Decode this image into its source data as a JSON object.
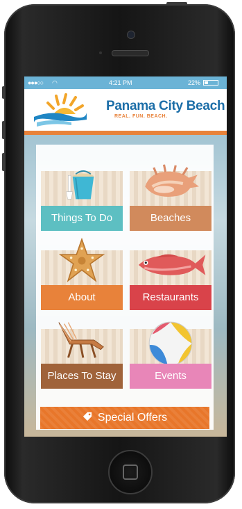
{
  "status_bar": {
    "time": "4:21 PM",
    "battery": "22%"
  },
  "header": {
    "brand": "Panama City Beach",
    "tagline": "REAL. FUN. BEACH."
  },
  "tiles": [
    {
      "label": "Things To Do",
      "color": "#5dbfc2",
      "icon": "sand-bucket-icon"
    },
    {
      "label": "Beaches",
      "color": "#d18a5c",
      "icon": "conch-shell-icon"
    },
    {
      "label": "About",
      "color": "#e8823a",
      "icon": "starfish-icon"
    },
    {
      "label": "Restaurants",
      "color": "#d9434a",
      "icon": "fish-icon"
    },
    {
      "label": "Places To Stay",
      "color": "#a0633a",
      "icon": "beach-chair-icon"
    },
    {
      "label": "Events",
      "color": "#e886b8",
      "icon": "beach-ball-icon"
    }
  ],
  "special_offers": {
    "label": "Special Offers",
    "icon": "tag-icon",
    "color": "#e8762a"
  }
}
